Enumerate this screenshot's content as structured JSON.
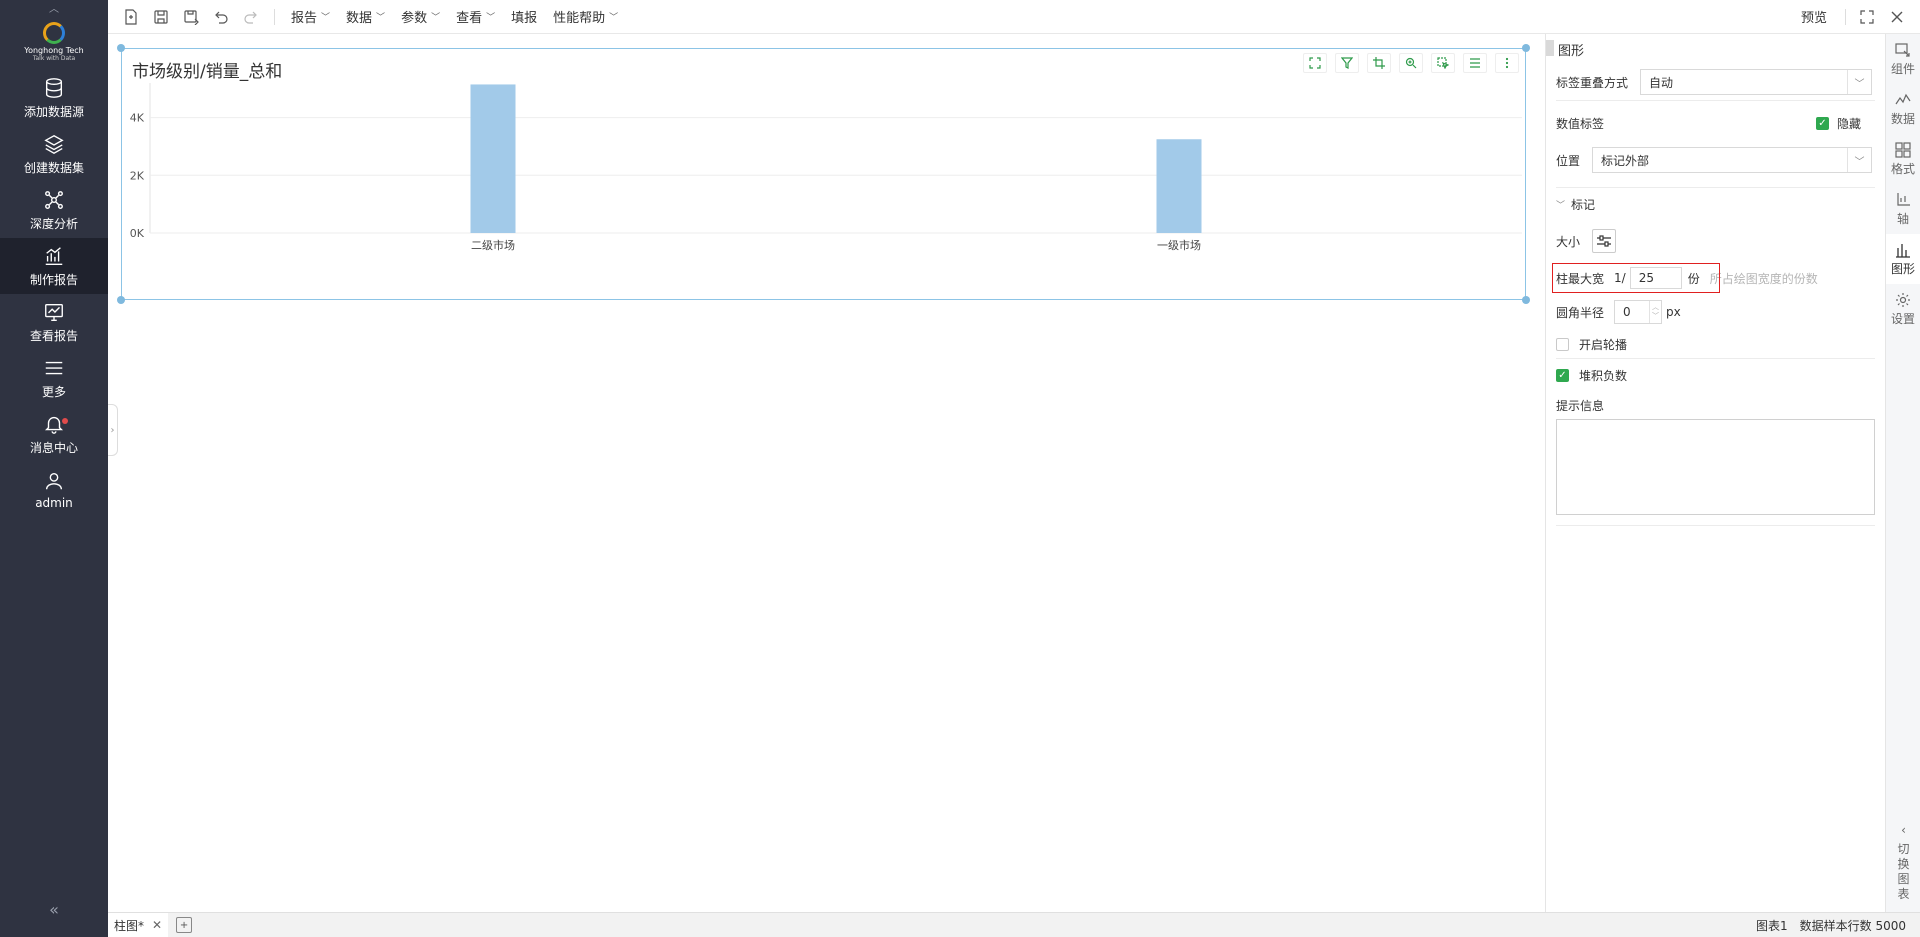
{
  "leftnav": {
    "logo_text": "Yonghong Tech",
    "logo_sub": "Talk with Data",
    "items": [
      {
        "label": "添加数据源"
      },
      {
        "label": "创建数据集"
      },
      {
        "label": "深度分析"
      },
      {
        "label": "制作报告"
      },
      {
        "label": "查看报告"
      },
      {
        "label": "更多"
      },
      {
        "label": "消息中心"
      },
      {
        "label": "admin"
      }
    ],
    "collapse": "«"
  },
  "toolbar": {
    "menus": [
      {
        "label": "报告"
      },
      {
        "label": "数据"
      },
      {
        "label": "参数"
      },
      {
        "label": "查看"
      },
      {
        "label": "填报",
        "no_chevron": true
      },
      {
        "label": "性能帮助"
      }
    ],
    "preview": "预览"
  },
  "chart": {
    "title": "市场级别/销量_总和"
  },
  "chart_data": {
    "type": "bar",
    "categories": [
      "二级市场",
      "一级市场"
    ],
    "values": [
      5150,
      3250
    ],
    "y_ticks": [
      {
        "v": 0,
        "label": "0K"
      },
      {
        "v": 2000,
        "label": "2K"
      },
      {
        "v": 4000,
        "label": "4K"
      }
    ],
    "ylim": [
      0,
      5200
    ],
    "grid": true,
    "color": "#a2cae9"
  },
  "panel": {
    "title": "图形",
    "overlap_label": "标签重叠方式",
    "overlap_value": "自动",
    "value_label": "数值标签",
    "hide_label": "隐藏",
    "position_label": "位置",
    "position_value": "标记外部",
    "mark_section": "标记",
    "size_label": "大小",
    "max_width_label": "柱最大宽",
    "max_width_prefix": "1/",
    "max_width_value": "25",
    "max_width_unit": "份",
    "max_width_hint": "所占绘图宽度的份数",
    "radius_label": "圆角半径",
    "radius_value": "0",
    "radius_unit": "px",
    "carousel_label": "开启轮播",
    "stack_label": "堆积负数",
    "tooltip_label": "提示信息"
  },
  "rtabs": {
    "items": [
      {
        "label": "组件"
      },
      {
        "label": "数据"
      },
      {
        "label": "格式"
      },
      {
        "label": "轴"
      },
      {
        "label": "图形"
      },
      {
        "label": "设置"
      }
    ],
    "switch_label": [
      "切",
      "换",
      "图",
      "表"
    ]
  },
  "statusbar": {
    "tab_label": "柱图*",
    "chart_name": "图表1",
    "sample_rows": "数据样本行数 5000"
  },
  "colors": {
    "accent_green": "#2fa84f",
    "nav_bg": "#2f3341",
    "highlight_red": "#e02020"
  }
}
